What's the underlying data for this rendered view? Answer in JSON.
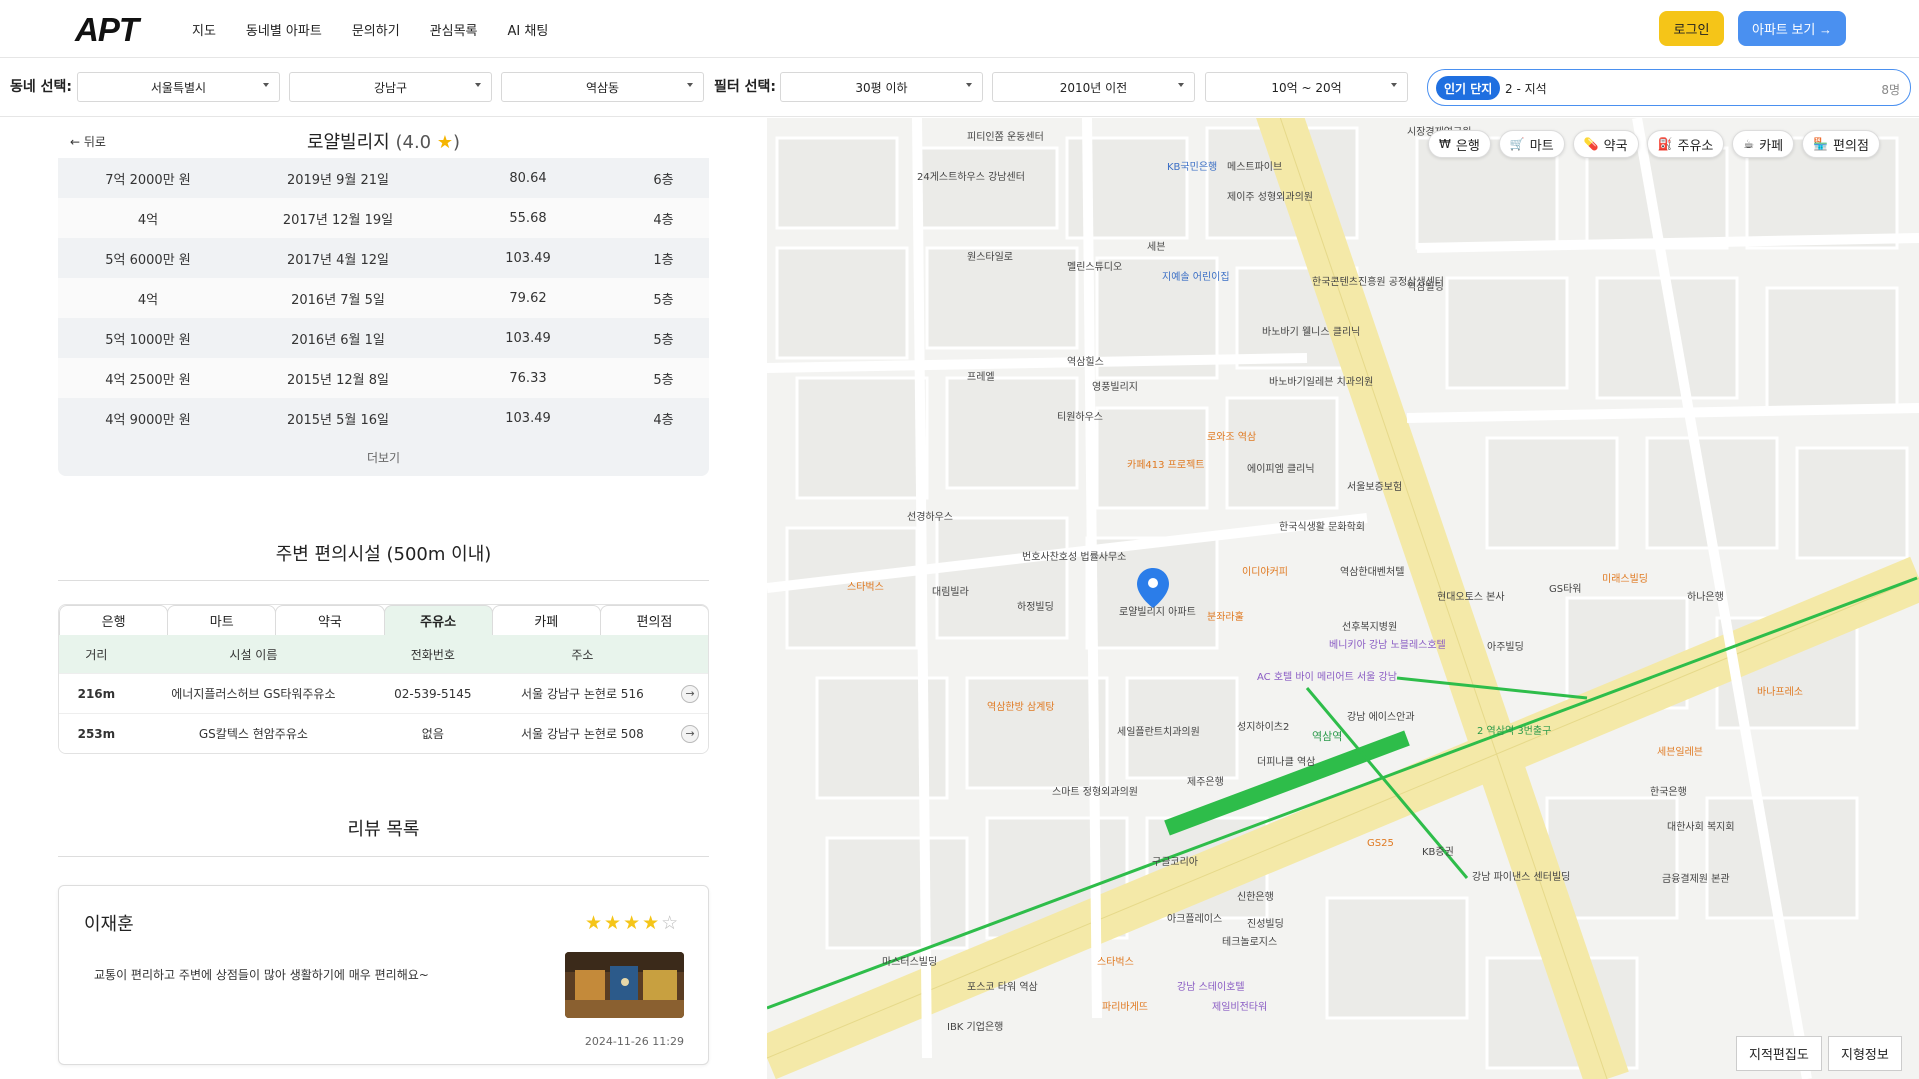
{
  "brand": {
    "logo": "APT"
  },
  "nav": {
    "items": [
      "지도",
      "동네별 아파트",
      "문의하기",
      "관심목록",
      "AI 채팅"
    ],
    "login": "로그인",
    "apt_button": "아파트 보기 →"
  },
  "filters": {
    "region_label": "동네 선택:",
    "city": "서울특별시",
    "district": "강남구",
    "dong": "역삼동",
    "filter_label": "필터 선택:",
    "size": "30평 이하",
    "year": "2010년 이전",
    "price": "10억 ~ 20억"
  },
  "search": {
    "pill": "인기 단지",
    "value": "2 - 지석",
    "count": "8명"
  },
  "detail": {
    "back": "← 뒤로",
    "name": "로얄빌리지",
    "rating": "(4.0",
    "rating_close": ")",
    "star": "★",
    "deals": [
      {
        "price": "7억 2000만 원",
        "date": "2019년 9월 21일",
        "area": "80.64",
        "floor": "6층"
      },
      {
        "price": "4억",
        "date": "2017년 12월 19일",
        "area": "55.68",
        "floor": "4층"
      },
      {
        "price": "5억 6000만 원",
        "date": "2017년 4월 12일",
        "area": "103.49",
        "floor": "1층"
      },
      {
        "price": "4억",
        "date": "2016년 7월 5일",
        "area": "79.62",
        "floor": "5층"
      },
      {
        "price": "5억 1000만 원",
        "date": "2016년 6월 1일",
        "area": "103.49",
        "floor": "5층"
      },
      {
        "price": "4억 2500만 원",
        "date": "2015년 12월 8일",
        "area": "76.33",
        "floor": "5층"
      },
      {
        "price": "4억 9000만 원",
        "date": "2015년 5월 16일",
        "area": "103.49",
        "floor": "4층"
      }
    ],
    "more": "더보기"
  },
  "facilities": {
    "title": "주변 편의시설 (500m 이내)",
    "tabs": [
      "은행",
      "마트",
      "약국",
      "주유소",
      "카페",
      "편의점"
    ],
    "active_tab": "주유소",
    "headers": [
      "거리",
      "시설 이름",
      "전화번호",
      "주소"
    ],
    "rows": [
      {
        "dist": "216m",
        "name": "에너지플러스허브 GS타워주유소",
        "phone": "02-539-5145",
        "addr": "서울 강남구 논현로 516"
      },
      {
        "dist": "253m",
        "name": "GS칼텍스 현암주유소",
        "phone": "없음",
        "addr": "서울 강남구 논현로 508"
      }
    ]
  },
  "reviews": {
    "title": "리뷰 목록",
    "items": [
      {
        "author": "이재훈",
        "rating": 4,
        "text": "교통이 편리하고 주변에 상점들이 많아 생활하기에 매우 편리해요~",
        "date": "2024-11-26 11:29"
      }
    ]
  },
  "map": {
    "chips": [
      {
        "icon": "₩",
        "label": "은행"
      },
      {
        "icon": "🛒",
        "label": "마트"
      },
      {
        "icon": "💊",
        "label": "약국"
      },
      {
        "icon": "⛽",
        "label": "주유소"
      },
      {
        "icon": "☕",
        "label": "카페"
      },
      {
        "icon": "🏪",
        "label": "편의점"
      }
    ],
    "cadastral": "지적편집도",
    "terrain": "지형정보",
    "marker_label": "로얄빌리지 아파트",
    "station": "역삼역",
    "station_sub": "2 역삼역 3번출구",
    "places": [
      "피티인쫌 운동센터",
      "24게스트하우스 강남센터",
      "시장경제연구원",
      "KB국민은행",
      "제이주 성형외과의원",
      "메스트파이브",
      "세븐",
      "원스타일로",
      "멜린스튜디오",
      "지예솔 어린이집",
      "한국콘텐츠진흥원 공정상생센터",
      "바노바기 웰니스 클리닉",
      "역삼빌딩",
      "프레엘",
      "역삼힐스",
      "영풍빌리지",
      "바노바기일레븐 치과의원",
      "티원하우스",
      "로와조 역삼",
      "카페413 프로젝트",
      "선경하우스",
      "번호사찬호성 법률사무소",
      "대림빌라",
      "하정빌딩",
      "에이피엠 클리닉",
      "서울보증보험",
      "한국식생활 문화학회",
      "역삼한대벤처텔",
      "베니키아 강남 노블레스호텔",
      "AC 호텔 바이 메리어트 서울 강남",
      "선후복지병원",
      "강남 에이스안과",
      "성지하이츠2",
      "세일플란트치과의원",
      "더피나클 역삼",
      "제주은행",
      "역삼한방 삼계탕",
      "스마트 정형외과의원",
      "구글코리아",
      "KB증권",
      "강남 파이낸스 센터빌딩",
      "신한은행",
      "진성빌딩",
      "아크플레이스",
      "테크놀로지스",
      "스타벅스",
      "포스코 타워 역삼",
      "IBK 기업은행",
      "제일비전타워",
      "한국은행",
      "금융결제원 본관",
      "대한사회 복지회",
      "마스터스빌딩",
      "강남 스테이호텔",
      "GS타워",
      "파리바게뜨",
      "세븐일레븐",
      "하나은행",
      "미래스빌딩",
      "이디야커피",
      "현대오토스 본사",
      "스타벅스",
      "바나프레소",
      "분좌라훌",
      "아주빌딩",
      "GS25"
    ]
  }
}
